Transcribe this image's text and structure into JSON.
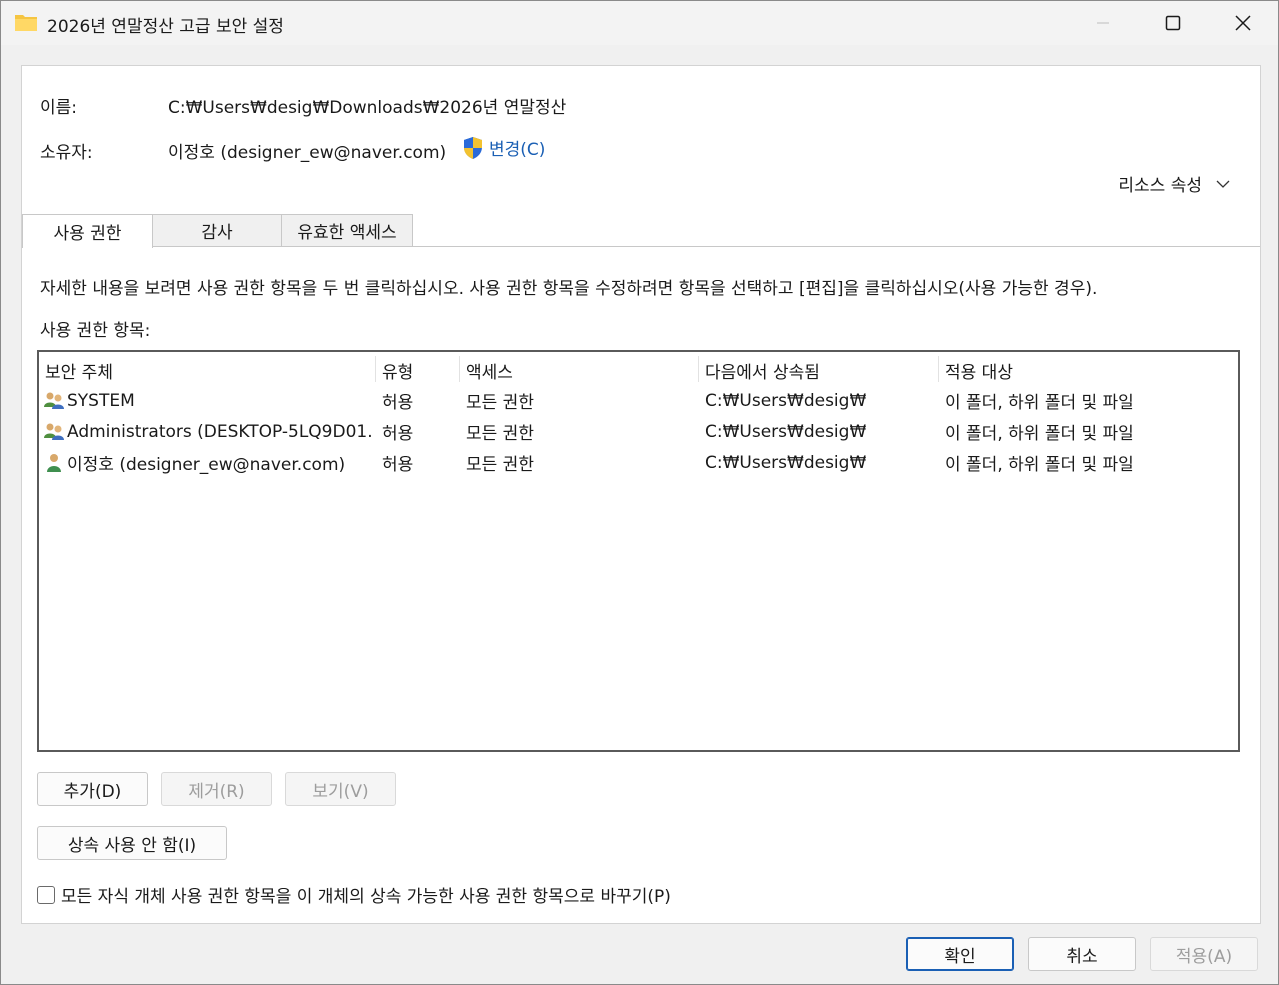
{
  "window": {
    "title": "2026년 연말정산 고급 보안 설정",
    "accent": "#1a5fb4"
  },
  "header": {
    "name_label": "이름:",
    "name_value": "C:₩Users₩desig₩Downloads₩2026년 연말정산",
    "owner_label": "소유자:",
    "owner_value": "이정호 (designer_ew@naver.com)",
    "change_link": "변경(C)",
    "resource_props": "리소스 속성"
  },
  "tabs": [
    {
      "label": "사용 권한",
      "active": true
    },
    {
      "label": "감사",
      "active": false
    },
    {
      "label": "유효한 액세스",
      "active": false
    }
  ],
  "permissions": {
    "description": "자세한 내용을 보려면 사용 권한 항목을 두 번 클릭하십시오. 사용 권한 항목을 수정하려면 항목을 선택하고 [편집]을 클릭하십시오(사용 가능한 경우).",
    "list_label": "사용 권한 항목:",
    "columns": [
      "보안 주체",
      "유형",
      "액세스",
      "다음에서 상속됨",
      "적용 대상"
    ],
    "rows": [
      {
        "icon": "group-users-icon",
        "principal": "SYSTEM",
        "type": "허용",
        "access": "모든 권한",
        "inherited": "C:₩Users₩desig₩",
        "applies": "이 폴더, 하위 폴더 및 파일"
      },
      {
        "icon": "group-users-icon",
        "principal": "Administrators (DESKTOP-5LQ9D01...",
        "type": "허용",
        "access": "모든 권한",
        "inherited": "C:₩Users₩desig₩",
        "applies": "이 폴더, 하위 폴더 및 파일"
      },
      {
        "icon": "user-icon",
        "principal": "이정호 (designer_ew@naver.com)",
        "type": "허용",
        "access": "모든 권한",
        "inherited": "C:₩Users₩desig₩",
        "applies": "이 폴더, 하위 폴더 및 파일"
      }
    ]
  },
  "buttons": {
    "add": "추가(D)",
    "remove": "제거(R)",
    "view": "보기(V)",
    "disable_inheritance": "상속 사용 안 함(I)",
    "replace_checkbox": "모든 자식 개체 사용 권한 항목을 이 개체의 상속 가능한 사용 권한 항목으로 바꾸기(P)",
    "ok": "확인",
    "cancel": "취소",
    "apply": "적용(A)"
  }
}
